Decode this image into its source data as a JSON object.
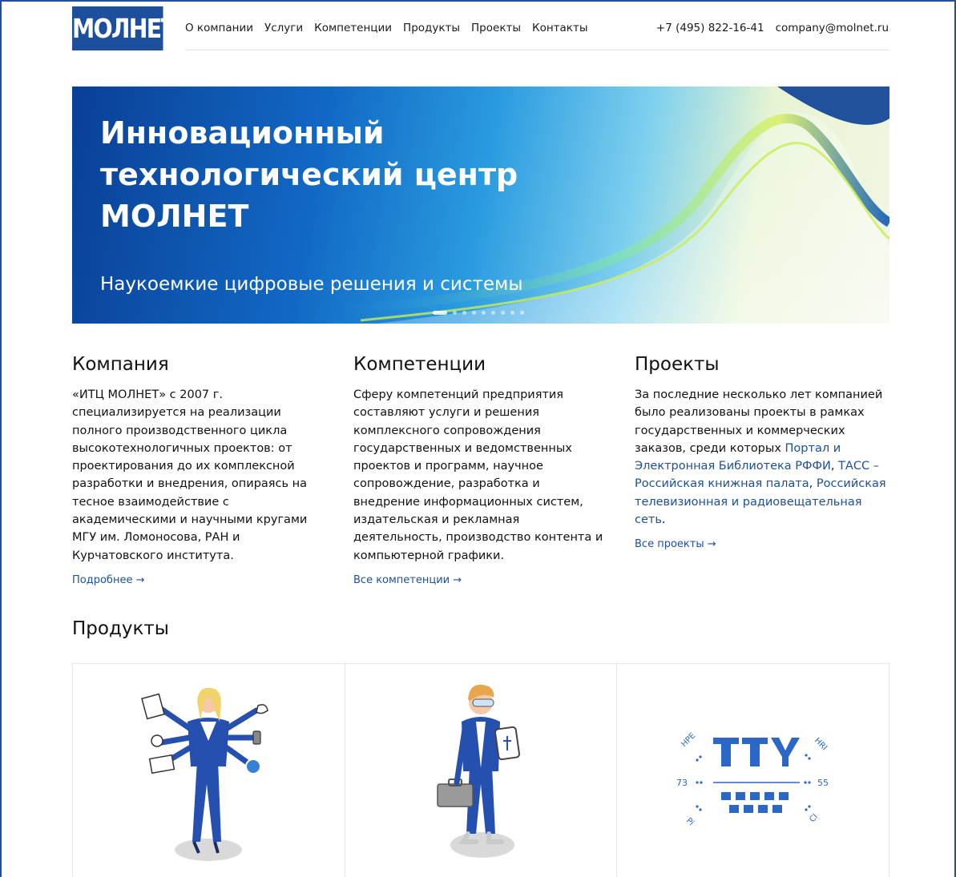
{
  "header": {
    "logo_text": "МОЛНЕТ",
    "nav": [
      "О компании",
      "Услуги",
      "Компетенции",
      "Продукты",
      "Проекты",
      "Контакты"
    ],
    "phone": "+7 (495) 822-16-41",
    "email": "company@molnet.ru"
  },
  "hero": {
    "title_lines": [
      "Инновационный",
      "технологический центр",
      "МОЛНЕТ"
    ],
    "subtitle": "Наукоемкие цифровые решения и системы",
    "slide_count": 9,
    "active_slide": 1
  },
  "company": {
    "title": "Компания",
    "text": "«ИТЦ МОЛНЕТ» с 2007 г. специализируется на реализации полного производственного цикла высокотехнологичных проектов: от проектирования до их комплексной разработки и внедрения, опираясь на тесное взаимодействие с академическими и научными кругами МГУ им. Ломоносова, РАН и Курчатовского института.",
    "more": "Подробнее →"
  },
  "competencies": {
    "title": "Компетенции",
    "text": "Сферу компетенций предприятия составляют услуги и решения комплексного сопровождения государственных и ведомственных проектов и программ, научное сопровождение, разработка и внедрение информационных систем, издательская и рекламная деятельность, производство контента и компьютерной графики.",
    "more": "Все компетенции →"
  },
  "projects": {
    "title": "Проекты",
    "text_before": "За последние несколько лет компанией было реализованы проекты в рамках государственных и коммерческих заказов, среди которых ",
    "link1": "Портал и Электронная Библиотека РФФИ",
    "sep1": ", ",
    "link2": "ТАСС – Российская книжная палата",
    "sep2": ", ",
    "link3": "Российская телевизионная и радиовещательная сеть",
    "end": ".",
    "more": "Все проекты →"
  },
  "products": {
    "title": "Продукты",
    "logo_left_top": "HPE",
    "logo_right_top": "HRI",
    "logo_left_num": "73",
    "logo_right_num": "55",
    "logo_left_bottom": "Pi",
    "logo_right_bottom": "Cl"
  },
  "colors": {
    "brand": "#1d4f9c",
    "link": "#1d4f9c"
  }
}
